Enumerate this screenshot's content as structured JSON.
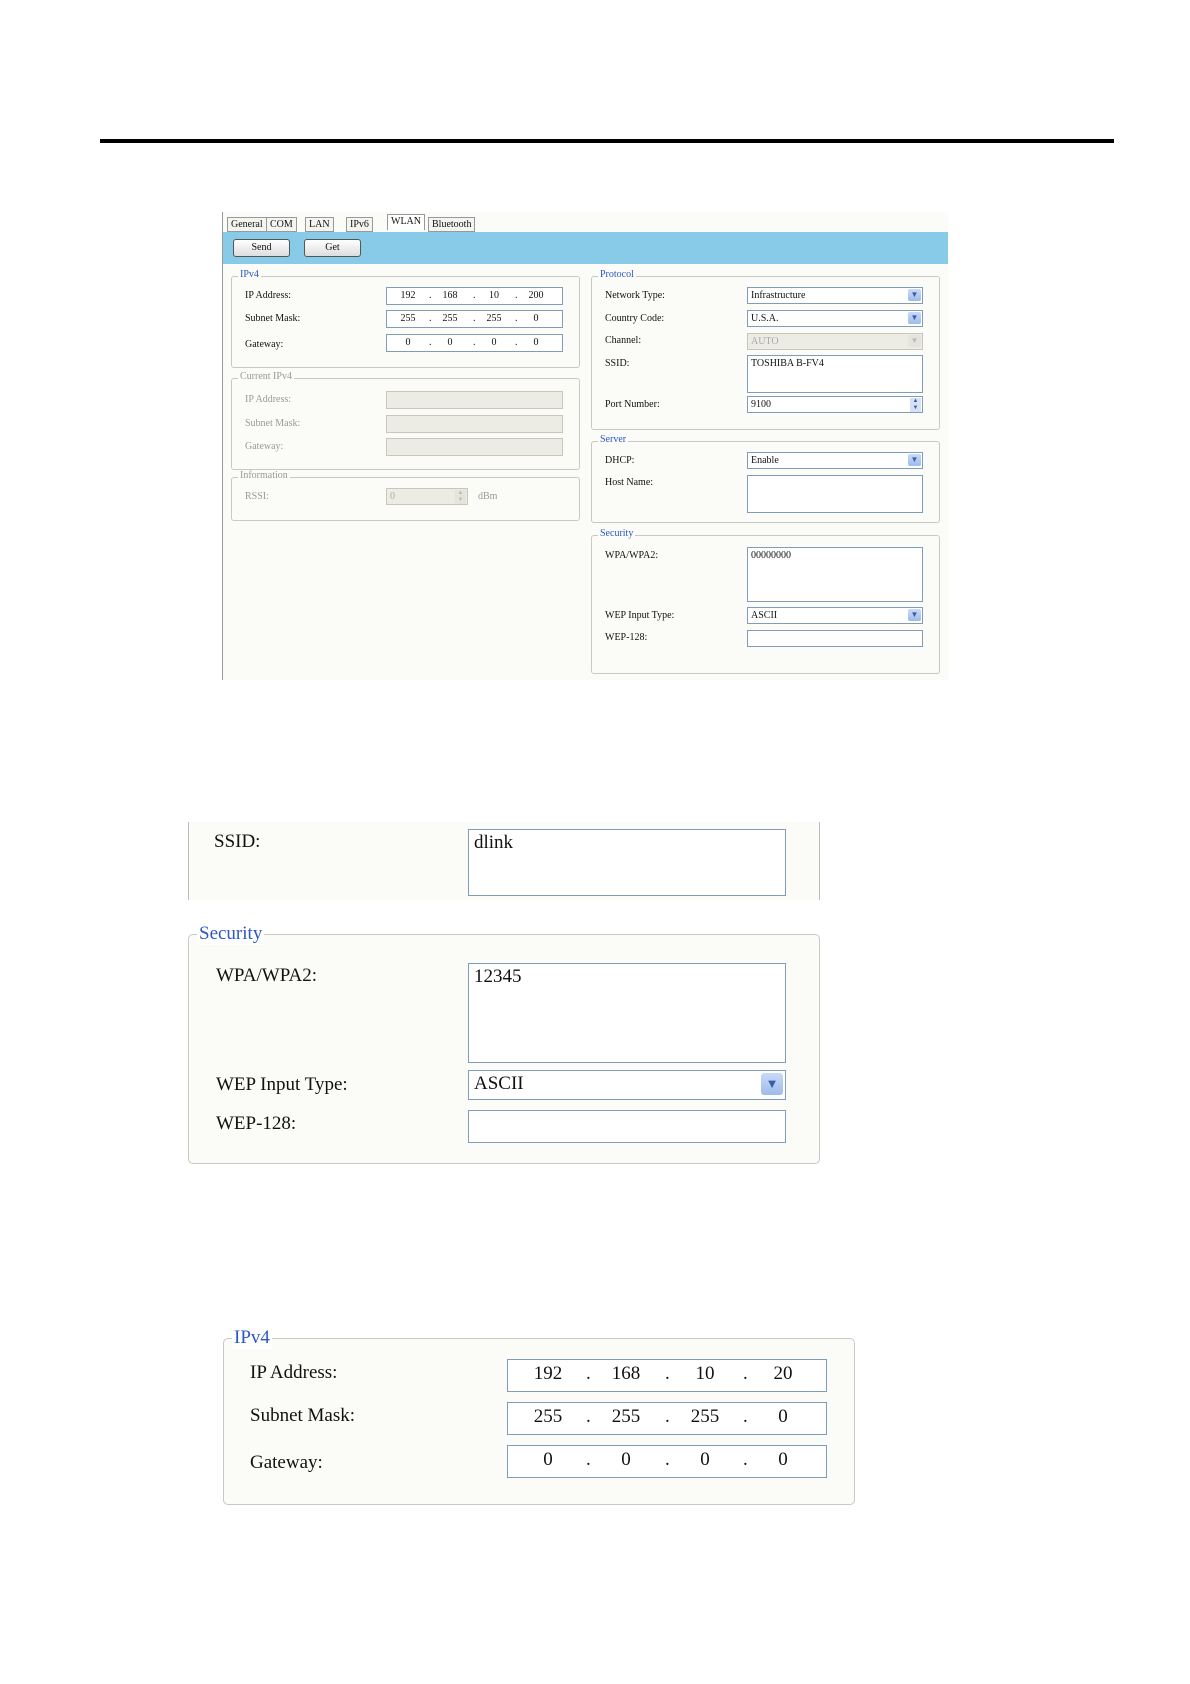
{
  "shot1": {
    "tabs": [
      "General",
      "COM",
      "LAN",
      "IPv6",
      "WLAN",
      "Bluetooth"
    ],
    "active_tab": "WLAN",
    "buttons": {
      "send": "Send",
      "get": "Get"
    },
    "ipv4": {
      "title": "IPv4",
      "ip_label": "IP Address:",
      "ip": [
        "192",
        "168",
        "10",
        "200"
      ],
      "mask_label": "Subnet Mask:",
      "mask": [
        "255",
        "255",
        "255",
        "0"
      ],
      "gateway_label": "Gateway:",
      "gateway": [
        "0",
        "0",
        "0",
        "0"
      ]
    },
    "current_ipv4": {
      "title": "Current IPv4",
      "ip_label": "IP Address:",
      "mask_label": "Subnet Mask:",
      "gateway_label": "Gateway:"
    },
    "information": {
      "title": "Information",
      "rssi_label": "RSSI:",
      "rssi_value": "0",
      "rssi_unit": "dBm"
    },
    "protocol": {
      "title": "Protocol",
      "network_type_label": "Network Type:",
      "network_type": "Infrastructure",
      "country_code_label": "Country Code:",
      "country_code": "U.S.A.",
      "channel_label": "Channel:",
      "channel": "AUTO",
      "ssid_label": "SSID:",
      "ssid": "TOSHIBA B-FV4",
      "port_label": "Port Number:",
      "port": "9100"
    },
    "server": {
      "title": "Server",
      "dhcp_label": "DHCP:",
      "dhcp": "Enable",
      "host_label": "Host Name:",
      "host": ""
    },
    "security": {
      "title": "Security",
      "wpa_label": "WPA/WPA2:",
      "wpa": "00000000",
      "wep_type_label": "WEP Input Type:",
      "wep_type": "ASCII",
      "wep128_label": "WEP-128:",
      "wep128": ""
    }
  },
  "shot2": {
    "ssid_label": "SSID:",
    "ssid": "dlink",
    "security_title": "Security",
    "wpa_label": "WPA/WPA2:",
    "wpa": "12345",
    "wep_type_label": "WEP Input Type:",
    "wep_type": "ASCII",
    "wep128_label": "WEP-128:",
    "wep128": ""
  },
  "shot3": {
    "title": "IPv4",
    "ip_label": "IP Address:",
    "ip": [
      "192",
      "168",
      "10",
      "20"
    ],
    "mask_label": "Subnet Mask:",
    "mask": [
      "255",
      "255",
      "255",
      "0"
    ],
    "gateway_label": "Gateway:",
    "gateway": [
      "0",
      "0",
      "0",
      "0"
    ]
  }
}
